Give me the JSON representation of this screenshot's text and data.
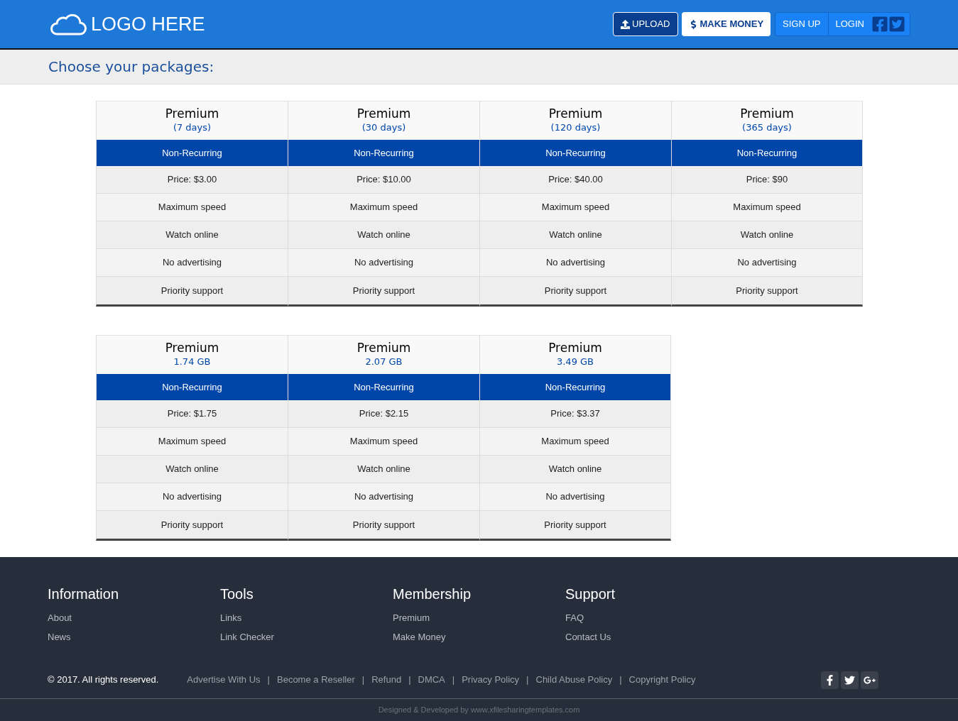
{
  "header": {
    "logo": "LOGO HERE",
    "buttons": [
      {
        "kind": "upload",
        "label": "UPLOAD"
      },
      {
        "kind": "money",
        "label": "MAKE MONEY"
      }
    ],
    "auth": [
      "SIGN UP",
      "LOGIN"
    ]
  },
  "page_title": "Choose your packages:",
  "package_groups": [
    {
      "packages": [
        {
          "title": "Premium",
          "subtitle": "(7 days)",
          "billing": "Non-Recurring",
          "rows": [
            "Price: $3.00",
            "Maximum speed",
            "Watch online",
            "No advertising",
            "Priority support"
          ]
        },
        {
          "title": "Premium",
          "subtitle": "(30 days)",
          "billing": "Non-Recurring",
          "rows": [
            "Price: $10.00",
            "Maximum speed",
            "Watch online",
            "No advertising",
            "Priority support"
          ]
        },
        {
          "title": "Premium",
          "subtitle": "(120 days)",
          "billing": "Non-Recurring",
          "rows": [
            "Price: $40.00",
            "Maximum speed",
            "Watch online",
            "No advertising",
            "Priority support"
          ]
        },
        {
          "title": "Premium",
          "subtitle": "(365 days)",
          "billing": "Non-Recurring",
          "rows": [
            "Price: $90",
            "Maximum speed",
            "Watch online",
            "No advertising",
            "Priority support"
          ]
        }
      ]
    },
    {
      "packages": [
        {
          "title": "Premium",
          "subtitle": "1.74 GB",
          "billing": "Non-Recurring",
          "rows": [
            "Price: $1.75",
            "Maximum speed",
            "Watch online",
            "No advertising",
            "Priority support"
          ]
        },
        {
          "title": "Premium",
          "subtitle": "2.07 GB",
          "billing": "Non-Recurring",
          "rows": [
            "Price: $2.15",
            "Maximum speed",
            "Watch online",
            "No advertising",
            "Priority support"
          ]
        },
        {
          "title": "Premium",
          "subtitle": "3.49 GB",
          "billing": "Non-Recurring",
          "rows": [
            "Price: $3.37",
            "Maximum speed",
            "Watch online",
            "No advertising",
            "Priority support"
          ]
        }
      ]
    }
  ],
  "footer": {
    "columns": [
      {
        "heading": "Information",
        "links": [
          "About",
          "News"
        ]
      },
      {
        "heading": "Tools",
        "links": [
          "Links",
          "Link Checker"
        ]
      },
      {
        "heading": "Membership",
        "links": [
          "Premium",
          "Make Money"
        ]
      },
      {
        "heading": "Support",
        "links": [
          "FAQ",
          "Contact Us"
        ]
      }
    ],
    "copyright": "© 2017. All rights reserved.",
    "bottom_links": [
      "Advertise With Us",
      "Become a Reseller",
      "Refund",
      "DMCA",
      "Privacy Policy",
      "Child Abuse Policy",
      "Copyright Policy"
    ],
    "separator": "|",
    "credit": "Designed & Developed by www.xfilesharingtemplates.com"
  }
}
